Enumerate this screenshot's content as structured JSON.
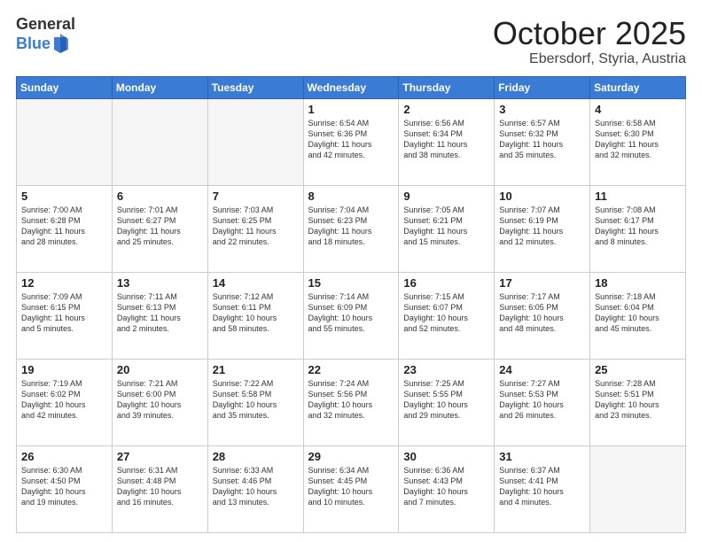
{
  "header": {
    "logo_general": "General",
    "logo_blue": "Blue",
    "month_title": "October 2025",
    "location": "Ebersdorf, Styria, Austria"
  },
  "weekdays": [
    "Sunday",
    "Monday",
    "Tuesday",
    "Wednesday",
    "Thursday",
    "Friday",
    "Saturday"
  ],
  "weeks": [
    [
      {
        "day": "",
        "info": ""
      },
      {
        "day": "",
        "info": ""
      },
      {
        "day": "",
        "info": ""
      },
      {
        "day": "1",
        "info": "Sunrise: 6:54 AM\nSunset: 6:36 PM\nDaylight: 11 hours\nand 42 minutes."
      },
      {
        "day": "2",
        "info": "Sunrise: 6:56 AM\nSunset: 6:34 PM\nDaylight: 11 hours\nand 38 minutes."
      },
      {
        "day": "3",
        "info": "Sunrise: 6:57 AM\nSunset: 6:32 PM\nDaylight: 11 hours\nand 35 minutes."
      },
      {
        "day": "4",
        "info": "Sunrise: 6:58 AM\nSunset: 6:30 PM\nDaylight: 11 hours\nand 32 minutes."
      }
    ],
    [
      {
        "day": "5",
        "info": "Sunrise: 7:00 AM\nSunset: 6:28 PM\nDaylight: 11 hours\nand 28 minutes."
      },
      {
        "day": "6",
        "info": "Sunrise: 7:01 AM\nSunset: 6:27 PM\nDaylight: 11 hours\nand 25 minutes."
      },
      {
        "day": "7",
        "info": "Sunrise: 7:03 AM\nSunset: 6:25 PM\nDaylight: 11 hours\nand 22 minutes."
      },
      {
        "day": "8",
        "info": "Sunrise: 7:04 AM\nSunset: 6:23 PM\nDaylight: 11 hours\nand 18 minutes."
      },
      {
        "day": "9",
        "info": "Sunrise: 7:05 AM\nSunset: 6:21 PM\nDaylight: 11 hours\nand 15 minutes."
      },
      {
        "day": "10",
        "info": "Sunrise: 7:07 AM\nSunset: 6:19 PM\nDaylight: 11 hours\nand 12 minutes."
      },
      {
        "day": "11",
        "info": "Sunrise: 7:08 AM\nSunset: 6:17 PM\nDaylight: 11 hours\nand 8 minutes."
      }
    ],
    [
      {
        "day": "12",
        "info": "Sunrise: 7:09 AM\nSunset: 6:15 PM\nDaylight: 11 hours\nand 5 minutes."
      },
      {
        "day": "13",
        "info": "Sunrise: 7:11 AM\nSunset: 6:13 PM\nDaylight: 11 hours\nand 2 minutes."
      },
      {
        "day": "14",
        "info": "Sunrise: 7:12 AM\nSunset: 6:11 PM\nDaylight: 10 hours\nand 58 minutes."
      },
      {
        "day": "15",
        "info": "Sunrise: 7:14 AM\nSunset: 6:09 PM\nDaylight: 10 hours\nand 55 minutes."
      },
      {
        "day": "16",
        "info": "Sunrise: 7:15 AM\nSunset: 6:07 PM\nDaylight: 10 hours\nand 52 minutes."
      },
      {
        "day": "17",
        "info": "Sunrise: 7:17 AM\nSunset: 6:05 PM\nDaylight: 10 hours\nand 48 minutes."
      },
      {
        "day": "18",
        "info": "Sunrise: 7:18 AM\nSunset: 6:04 PM\nDaylight: 10 hours\nand 45 minutes."
      }
    ],
    [
      {
        "day": "19",
        "info": "Sunrise: 7:19 AM\nSunset: 6:02 PM\nDaylight: 10 hours\nand 42 minutes."
      },
      {
        "day": "20",
        "info": "Sunrise: 7:21 AM\nSunset: 6:00 PM\nDaylight: 10 hours\nand 39 minutes."
      },
      {
        "day": "21",
        "info": "Sunrise: 7:22 AM\nSunset: 5:58 PM\nDaylight: 10 hours\nand 35 minutes."
      },
      {
        "day": "22",
        "info": "Sunrise: 7:24 AM\nSunset: 5:56 PM\nDaylight: 10 hours\nand 32 minutes."
      },
      {
        "day": "23",
        "info": "Sunrise: 7:25 AM\nSunset: 5:55 PM\nDaylight: 10 hours\nand 29 minutes."
      },
      {
        "day": "24",
        "info": "Sunrise: 7:27 AM\nSunset: 5:53 PM\nDaylight: 10 hours\nand 26 minutes."
      },
      {
        "day": "25",
        "info": "Sunrise: 7:28 AM\nSunset: 5:51 PM\nDaylight: 10 hours\nand 23 minutes."
      }
    ],
    [
      {
        "day": "26",
        "info": "Sunrise: 6:30 AM\nSunset: 4:50 PM\nDaylight: 10 hours\nand 19 minutes."
      },
      {
        "day": "27",
        "info": "Sunrise: 6:31 AM\nSunset: 4:48 PM\nDaylight: 10 hours\nand 16 minutes."
      },
      {
        "day": "28",
        "info": "Sunrise: 6:33 AM\nSunset: 4:46 PM\nDaylight: 10 hours\nand 13 minutes."
      },
      {
        "day": "29",
        "info": "Sunrise: 6:34 AM\nSunset: 4:45 PM\nDaylight: 10 hours\nand 10 minutes."
      },
      {
        "day": "30",
        "info": "Sunrise: 6:36 AM\nSunset: 4:43 PM\nDaylight: 10 hours\nand 7 minutes."
      },
      {
        "day": "31",
        "info": "Sunrise: 6:37 AM\nSunset: 4:41 PM\nDaylight: 10 hours\nand 4 minutes."
      },
      {
        "day": "",
        "info": ""
      }
    ]
  ]
}
